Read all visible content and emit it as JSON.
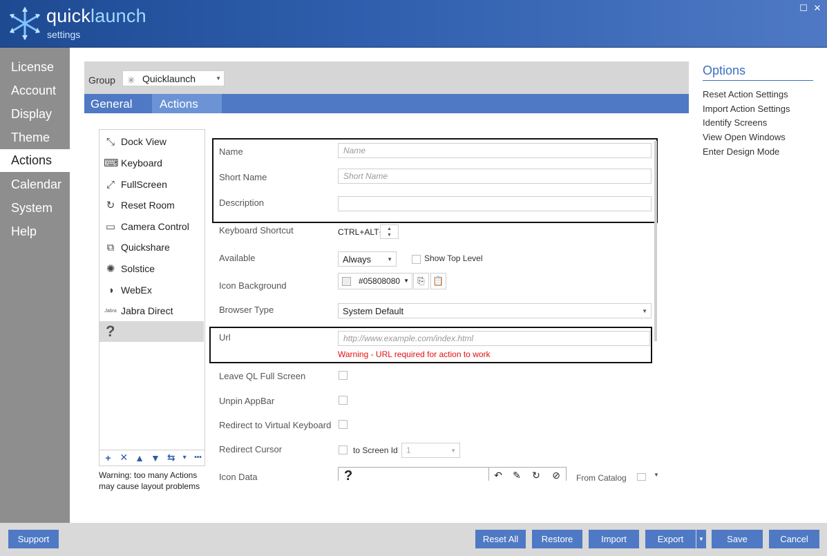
{
  "app": {
    "brand_quick": "quick",
    "brand_launch": "launch",
    "subtitle": "settings"
  },
  "window": {
    "maximize_glyph": "☐",
    "close_glyph": "✕"
  },
  "nav": {
    "items": [
      {
        "label": "License"
      },
      {
        "label": "Account"
      },
      {
        "label": "Display"
      },
      {
        "label": "Theme"
      },
      {
        "label": "Actions"
      },
      {
        "label": "Calendar"
      },
      {
        "label": "System"
      },
      {
        "label": "Help"
      }
    ],
    "active": "Actions"
  },
  "group": {
    "label": "Group",
    "value": "Quicklaunch",
    "icon": "quicklaunch-star-icon"
  },
  "tabs": [
    {
      "label": "General"
    },
    {
      "label": "Actions"
    }
  ],
  "actions": {
    "items": [
      {
        "label": "Dock View",
        "icon": "compress-arrows-icon",
        "glyph": "⤡"
      },
      {
        "label": "Keyboard",
        "icon": "keyboard-icon",
        "glyph": "⌨"
      },
      {
        "label": "FullScreen",
        "icon": "expand-arrows-icon",
        "glyph": "⤢"
      },
      {
        "label": "Reset Room",
        "icon": "refresh-icon",
        "glyph": "↻"
      },
      {
        "label": "Camera Control",
        "icon": "camera-icon",
        "glyph": "▭"
      },
      {
        "label": "Quickshare",
        "icon": "share-screen-icon",
        "glyph": "⧉"
      },
      {
        "label": "Solstice",
        "icon": "solstice-icon",
        "glyph": "✺"
      },
      {
        "label": "WebEx",
        "icon": "webex-icon",
        "glyph": "◑"
      },
      {
        "label": "Jabra Direct",
        "icon": "jabra-logo-icon",
        "glyph": "Jabra"
      }
    ],
    "selected_glyph": "?",
    "toolbar": [
      "+",
      "✕",
      "▲",
      "▼",
      "⇆",
      "▾",
      "•••"
    ],
    "warning": "Warning: too many Actions may cause layout problems"
  },
  "form": {
    "name": {
      "label": "Name",
      "placeholder": "Name"
    },
    "short_name": {
      "label": "Short Name",
      "placeholder": "Short Name"
    },
    "description": {
      "label": "Description"
    },
    "keyboard_shortcut": {
      "label": "Keyboard Shortcut",
      "value": "CTRL+ALT+"
    },
    "available": {
      "label": "Available",
      "value": "Always"
    },
    "show_top_level": {
      "label": "Show Top Level"
    },
    "icon_background": {
      "label": "Icon Background",
      "value": "#05808080"
    },
    "browser_type": {
      "label": "Browser Type",
      "value": "System Default"
    },
    "url": {
      "label": "Url",
      "placeholder": "http://www.example.com/index.html",
      "warning": "Warning - URL required for action to work"
    },
    "leave_fullscreen": {
      "label": "Leave QL Full Screen"
    },
    "unpin_appbar": {
      "label": "Unpin AppBar"
    },
    "redirect_keyboard": {
      "label": "Redirect to Virtual Keyboard"
    },
    "redirect_cursor": {
      "label": "Redirect Cursor",
      "to_screen_label": "to Screen Id",
      "screen_value": "1"
    },
    "icon_data": {
      "label": "Icon Data",
      "preview_glyph": "?",
      "from_catalog_label": "From Catalog"
    }
  },
  "options": {
    "title": "Options",
    "links": [
      {
        "label": "Reset Action Settings"
      },
      {
        "label": "Import Action Settings"
      },
      {
        "label": "Identify Screens"
      },
      {
        "label": "View Open Windows"
      },
      {
        "label": "Enter Design Mode"
      }
    ]
  },
  "footer": {
    "support": "Support",
    "reset_all": "Reset All",
    "restore": "Restore",
    "import": "Import",
    "export": "Export",
    "save": "Save",
    "cancel": "Cancel"
  },
  "colors": {
    "accent": "#4f79c4",
    "header": "#2f5fae",
    "nav_bg": "#8e8e8e",
    "warning": "#e01010"
  }
}
